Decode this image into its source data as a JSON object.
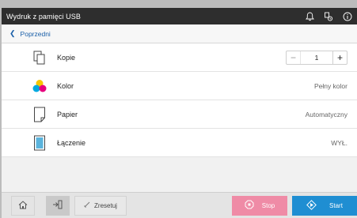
{
  "header": {
    "title": "Wydruk z pamięci USB",
    "icons": [
      "bell-icon",
      "device-status-icon",
      "info-icon"
    ]
  },
  "nav": {
    "back_label": "Poprzedni"
  },
  "settings": [
    {
      "label": "Kopie",
      "icon": "copies-icon",
      "value": "1"
    },
    {
      "label": "Kolor",
      "icon": "color-icon",
      "value": "Pełny kolor"
    },
    {
      "label": "Papier",
      "icon": "paper-icon",
      "value": "Automatyczny"
    },
    {
      "label": "Łączenie",
      "icon": "combine-icon",
      "value": "WYŁ."
    }
  ],
  "stepper": {
    "minus": "−",
    "plus": "+"
  },
  "bottom": {
    "reset_label": "Zresetuj",
    "stop_label": "Stop",
    "start_label": "Start"
  },
  "colors": {
    "title_bg": "#2e2e2e",
    "link": "#1a5fa8",
    "stop": "#ef8ba6",
    "start": "#1f8ed2"
  }
}
